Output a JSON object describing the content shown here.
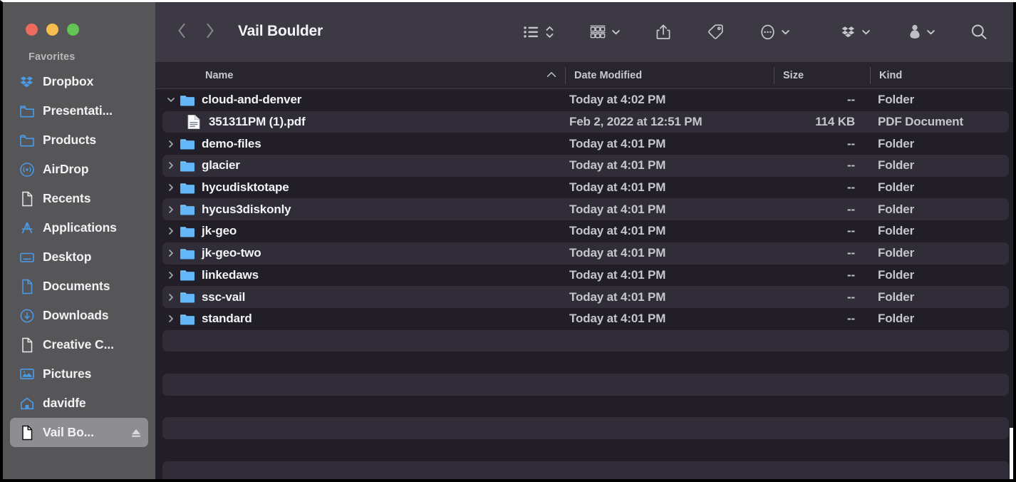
{
  "window": {
    "traffic_lights": [
      {
        "name": "close",
        "color": "#ED6B5E"
      },
      {
        "name": "minimize",
        "color": "#F5BE4F"
      },
      {
        "name": "maximize",
        "color": "#61C455"
      }
    ]
  },
  "sidebar": {
    "section_title": "Favorites",
    "items": [
      {
        "label": "Dropbox",
        "icon": "dropbox-icon",
        "selected": false
      },
      {
        "label": "Presentati...",
        "icon": "folder-icon",
        "selected": false
      },
      {
        "label": "Products",
        "icon": "folder-icon",
        "selected": false
      },
      {
        "label": "AirDrop",
        "icon": "airdrop-icon",
        "selected": false
      },
      {
        "label": "Recents",
        "icon": "recents-icon",
        "selected": false
      },
      {
        "label": "Applications",
        "icon": "applications-icon",
        "selected": false
      },
      {
        "label": "Desktop",
        "icon": "desktop-icon",
        "selected": false
      },
      {
        "label": "Documents",
        "icon": "documents-icon",
        "selected": false
      },
      {
        "label": "Downloads",
        "icon": "downloads-icon",
        "selected": false
      },
      {
        "label": "Creative C...",
        "icon": "document-icon",
        "selected": false
      },
      {
        "label": "Pictures",
        "icon": "pictures-icon",
        "selected": false
      },
      {
        "label": "davidfe",
        "icon": "home-icon",
        "selected": false
      },
      {
        "label": "Vail Bo...",
        "icon": "document-icon",
        "selected": true,
        "eject": true
      }
    ]
  },
  "toolbar": {
    "back_label": "Back",
    "forward_label": "Forward",
    "title": "Vail Boulder",
    "buttons": [
      {
        "name": "view-list-button",
        "icon": "list-view-icon",
        "has_chevron": true
      },
      {
        "name": "group-by-button",
        "icon": "grid-group-icon",
        "has_chevron": true
      },
      {
        "name": "share-button",
        "icon": "share-icon",
        "has_chevron": false
      },
      {
        "name": "tag-button",
        "icon": "tag-icon",
        "has_chevron": false
      },
      {
        "name": "more-actions-button",
        "icon": "ellipsis-icon",
        "has_chevron": true
      },
      {
        "name": "dropbox-button",
        "icon": "dropbox-icon",
        "has_chevron": true
      },
      {
        "name": "account-button",
        "icon": "person-icon",
        "has_chevron": true
      },
      {
        "name": "search-button",
        "icon": "search-icon",
        "has_chevron": false
      }
    ]
  },
  "columns": {
    "headers": [
      {
        "label": "Name",
        "sorted": true,
        "sort_direction": "ascending"
      },
      {
        "label": "Date Modified",
        "sorted": false
      },
      {
        "label": "Size",
        "sorted": false
      },
      {
        "label": "Kind",
        "sorted": false
      }
    ]
  },
  "files": [
    {
      "name": "cloud-and-denver",
      "icon": "folder-icon",
      "disclosure": "expanded",
      "indent": 0,
      "date": "Today at 4:02 PM",
      "size": "--",
      "kind": "Folder",
      "stripe": false
    },
    {
      "name": "351311PM (1).pdf",
      "icon": "pdf-icon",
      "disclosure": "none",
      "indent": 1,
      "date": "Feb 2, 2022 at 12:51 PM",
      "size": "114 KB",
      "kind": "PDF Document",
      "stripe": true
    },
    {
      "name": "demo-files",
      "icon": "folder-icon",
      "disclosure": "collapsed",
      "indent": 0,
      "date": "Today at 4:01 PM",
      "size": "--",
      "kind": "Folder",
      "stripe": false
    },
    {
      "name": "glacier",
      "icon": "folder-icon",
      "disclosure": "collapsed",
      "indent": 0,
      "date": "Today at 4:01 PM",
      "size": "--",
      "kind": "Folder",
      "stripe": true
    },
    {
      "name": "hycudisktotape",
      "icon": "folder-icon",
      "disclosure": "collapsed",
      "indent": 0,
      "date": "Today at 4:01 PM",
      "size": "--",
      "kind": "Folder",
      "stripe": false
    },
    {
      "name": "hycus3diskonly",
      "icon": "folder-icon",
      "disclosure": "collapsed",
      "indent": 0,
      "date": "Today at 4:01 PM",
      "size": "--",
      "kind": "Folder",
      "stripe": true
    },
    {
      "name": "jk-geo",
      "icon": "folder-icon",
      "disclosure": "collapsed",
      "indent": 0,
      "date": "Today at 4:01 PM",
      "size": "--",
      "kind": "Folder",
      "stripe": false
    },
    {
      "name": "jk-geo-two",
      "icon": "folder-icon",
      "disclosure": "collapsed",
      "indent": 0,
      "date": "Today at 4:01 PM",
      "size": "--",
      "kind": "Folder",
      "stripe": true
    },
    {
      "name": "linkedaws",
      "icon": "folder-icon",
      "disclosure": "collapsed",
      "indent": 0,
      "date": "Today at 4:01 PM",
      "size": "--",
      "kind": "Folder",
      "stripe": false
    },
    {
      "name": "ssc-vail",
      "icon": "folder-icon",
      "disclosure": "collapsed",
      "indent": 0,
      "date": "Today at 4:01 PM",
      "size": "--",
      "kind": "Folder",
      "stripe": true
    },
    {
      "name": "standard",
      "icon": "folder-icon",
      "disclosure": "collapsed",
      "indent": 0,
      "date": "Today at 4:01 PM",
      "size": "--",
      "kind": "Folder",
      "stripe": false
    }
  ],
  "empty_rows": [
    {
      "stripe": true
    },
    {
      "stripe": false
    },
    {
      "stripe": true
    },
    {
      "stripe": false
    },
    {
      "stripe": true
    },
    {
      "stripe": false
    },
    {
      "stripe": true
    }
  ],
  "colors": {
    "sidebar_bg": "#565658",
    "toolbar_bg": "#3C3944",
    "content_bg": "#211E27",
    "stripe_bg": "#302C38",
    "header_bg": "#29252F",
    "folder_blue": "#5FB4F5",
    "selected_bg": "#8E8E92",
    "text_primary": "#F3F3F5",
    "text_secondary": "#C6C5CB"
  }
}
